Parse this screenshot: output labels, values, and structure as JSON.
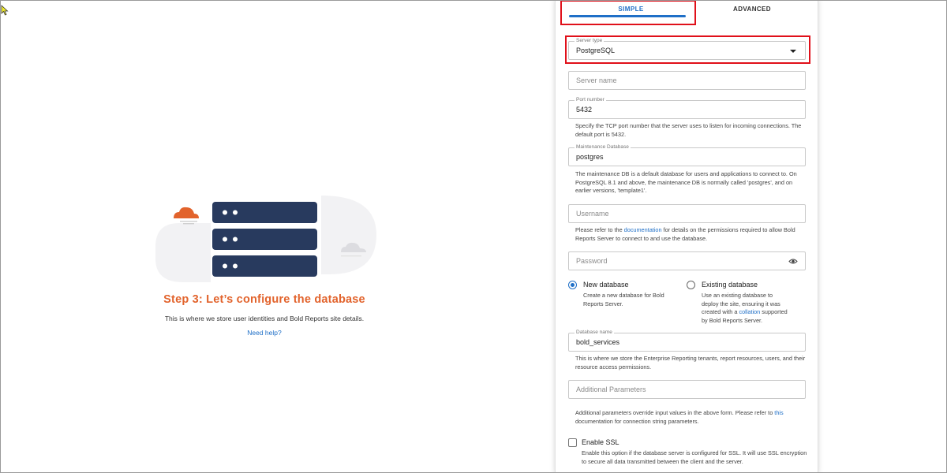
{
  "left": {
    "title": "Step 3: Let’s configure the database",
    "description": "This is where we store user identities and Bold Reports site details.",
    "help_link": "Need help?"
  },
  "tabs": [
    {
      "label": "SIMPLE",
      "active": true
    },
    {
      "label": "ADVANCED",
      "active": false
    }
  ],
  "form": {
    "server_type": {
      "label": "Server type",
      "value": "PostgreSQL"
    },
    "server_name": {
      "placeholder": "Server name"
    },
    "port": {
      "label": "Port number",
      "value": "5432",
      "help": "Specify the TCP port number that the server uses to listen for incoming connections. The default port is 5432."
    },
    "maintenance_db": {
      "label": "Maintenance Database",
      "value": "postgres",
      "help": "The maintenance DB is a default database for users and applications to connect to. On PostgreSQL 8.1 and above, the maintenance DB is normally called 'postgres', and on earlier versions, 'template1'."
    },
    "username": {
      "placeholder": "Username",
      "help_before": "Please refer to the ",
      "help_link": "documentation",
      "help_after": " for details on the permissions required to allow Bold Reports Server to connect to and use the database."
    },
    "password": {
      "placeholder": "Password"
    },
    "db_choice": {
      "new": {
        "label": "New database",
        "help": "Create a new database for Bold Reports Server.",
        "checked": true
      },
      "existing": {
        "label": "Existing database",
        "help_before": "Use an existing database to deploy the site, ensuring it was created with a ",
        "help_link": "collation",
        "help_after": " supported by Bold Reports Server.",
        "checked": false
      }
    },
    "database_name": {
      "label": "Database name",
      "value": "bold_services",
      "help": "This is where we store the Enterprise Reporting tenants, report resources, users, and their resource access permissions."
    },
    "additional_params": {
      "placeholder": "Additional Parameters",
      "help_before": "Additional parameters override input values in the above form. Please refer to ",
      "help_link": "this",
      "help_after": " documentation for connection string parameters."
    },
    "ssl": {
      "label": "Enable SSL",
      "help": "Enable this option if the database server is configured for SSL. It will use SSL encryption to secure all data transmitted between the client and the server."
    }
  },
  "colors": {
    "accent": "#1f6fc7",
    "step_title": "#e2632c",
    "server_navy": "#283a5e",
    "cloud_orange": "#e2632c",
    "highlight": "#e0101a"
  },
  "icons": {
    "dropdown": "caret-down-icon",
    "password_visibility": "eye-icon",
    "cursor": "mouse-pointer-icon"
  }
}
